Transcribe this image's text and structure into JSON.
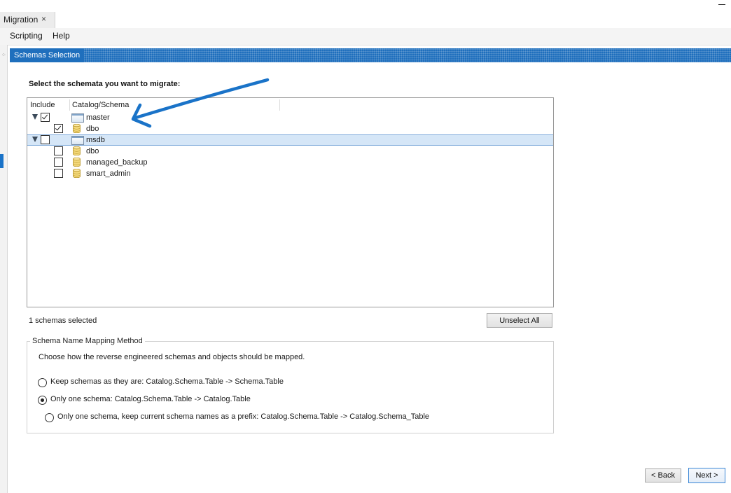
{
  "tab": {
    "title": "Migration",
    "close_glyph": "×"
  },
  "menubar": {
    "items": [
      "Scripting",
      "Help"
    ]
  },
  "header": {
    "title": "Schemas Selection"
  },
  "main": {
    "instruction": "Select the schemata you want to migrate:",
    "columns": {
      "include": "Include",
      "catalog_schema": "Catalog/Schema"
    },
    "tree": [
      {
        "type": "catalog",
        "label": "master",
        "checked": true,
        "expanded": true,
        "selected": false,
        "icon": "catalog-icon"
      },
      {
        "type": "schema",
        "label": "dbo",
        "checked": true,
        "icon": "database-icon"
      },
      {
        "type": "catalog",
        "label": "msdb",
        "checked": false,
        "expanded": true,
        "selected": true,
        "icon": "catalog-icon"
      },
      {
        "type": "schema",
        "label": "dbo",
        "checked": false,
        "icon": "database-icon"
      },
      {
        "type": "schema",
        "label": "managed_backup",
        "checked": false,
        "icon": "database-icon"
      },
      {
        "type": "schema",
        "label": "smart_admin",
        "checked": false,
        "icon": "database-icon"
      }
    ],
    "status": "1 schemas selected",
    "unselect_all_label": "Unselect All",
    "mapping": {
      "legend": "Schema Name Mapping Method",
      "description": "Choose how the reverse engineered schemas and objects should be mapped.",
      "options": [
        {
          "label": "Keep schemas as they are: Catalog.Schema.Table -> Schema.Table",
          "selected": false
        },
        {
          "label": "Only one schema: Catalog.Schema.Table -> Catalog.Table",
          "selected": true
        },
        {
          "label": "Only one schema, keep current schema names as a prefix: Catalog.Schema.Table -> Catalog.Schema_Table",
          "selected": false
        }
      ]
    }
  },
  "footer": {
    "back_label": "< Back",
    "next_label": "Next >"
  },
  "colors": {
    "header_blue": "#1f6fbd",
    "selection_fill": "#d5e6f7",
    "annotation_arrow": "#1a73c8"
  }
}
